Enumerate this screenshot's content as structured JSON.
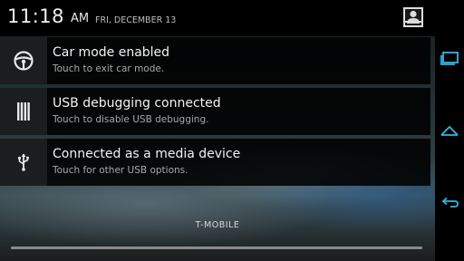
{
  "status_header": {
    "time": "11:18",
    "ampm": "AM",
    "date": "FRI, DECEMBER 13",
    "settings_icon": "quick-settings-icon"
  },
  "notifications": [
    {
      "icon": "steering-wheel-icon",
      "title": "Car mode enabled",
      "subtitle": "Touch to exit car mode."
    },
    {
      "icon": "usb-debug-icon",
      "title": "USB debugging connected",
      "subtitle": "Touch to disable USB debugging."
    },
    {
      "icon": "usb-icon",
      "title": "Connected as a media device",
      "subtitle": "Touch for other USB options."
    }
  ],
  "carrier": "T-MOBILE",
  "nav_bar": {
    "buttons": [
      "recent-apps-icon",
      "home-icon",
      "back-icon"
    ],
    "accent_color": "#33b5e5"
  }
}
